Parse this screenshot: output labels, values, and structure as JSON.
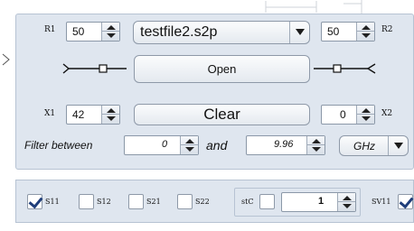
{
  "port_row": {
    "r1_label": "R1",
    "r1_value": "50",
    "file_name": "testfile2.s2p",
    "r2_value": "50",
    "r2_label": "R2"
  },
  "open_button": "Open",
  "reactance_row": {
    "x1_label": "X1",
    "x1_value": "42",
    "clear_button": "Clear",
    "x2_value": "0",
    "x2_label": "X2"
  },
  "filter_row": {
    "filter_label": "Filter between",
    "from_value": "0",
    "and_label": "and",
    "to_value": "9.96",
    "unit": "GHz"
  },
  "params": {
    "s11": {
      "label": "S11",
      "checked": true
    },
    "s12": {
      "label": "S12",
      "checked": false
    },
    "s21": {
      "label": "S21",
      "checked": false
    },
    "s22": {
      "label": "S22",
      "checked": false
    },
    "stc_label": "stC",
    "stc_checked": false,
    "stc_value": "1",
    "sv11_label": "SV11",
    "sv11_checked": true
  },
  "colors": {
    "panel_bg": "#dfe6ef",
    "check_mark": "#1f3e7a"
  },
  "icons": {
    "left_port": "port-connector-left-icon",
    "right_port": "port-connector-right-icon"
  }
}
